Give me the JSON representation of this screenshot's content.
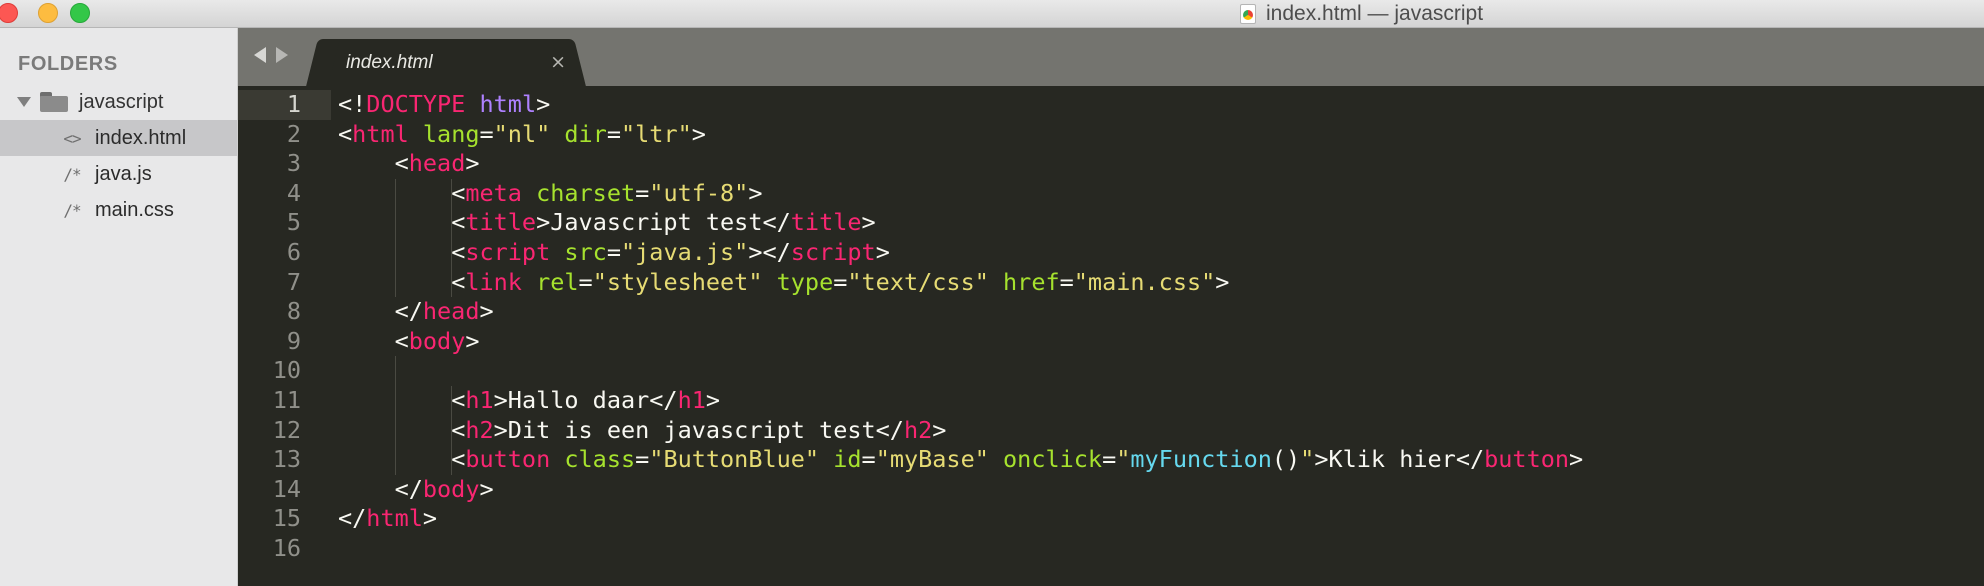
{
  "window": {
    "title": "index.html — javascript"
  },
  "sidebar": {
    "header": "FOLDERS",
    "folder": {
      "name": "javascript"
    },
    "files": [
      {
        "icon": "<>",
        "name": "index.html",
        "selected": true
      },
      {
        "icon": "/*",
        "name": "java.js",
        "selected": false
      },
      {
        "icon": "/*",
        "name": "main.css",
        "selected": false
      }
    ]
  },
  "tab": {
    "label": "index.html",
    "close": "×"
  },
  "editor": {
    "current_line": 1,
    "lines": [
      {
        "n": "1",
        "indent": 0,
        "tokens": [
          [
            "pun",
            "<!"
          ],
          [
            "tag",
            "DOCTYPE"
          ],
          [
            "txt",
            " "
          ],
          [
            "kw",
            "html"
          ],
          [
            "pun",
            ">"
          ]
        ]
      },
      {
        "n": "2",
        "indent": 0,
        "tokens": [
          [
            "pun",
            "<"
          ],
          [
            "tag",
            "html"
          ],
          [
            "txt",
            " "
          ],
          [
            "attr",
            "lang"
          ],
          [
            "pun",
            "="
          ],
          [
            "str",
            "\"nl\""
          ],
          [
            "txt",
            " "
          ],
          [
            "attr",
            "dir"
          ],
          [
            "pun",
            "="
          ],
          [
            "str",
            "\"ltr\""
          ],
          [
            "pun",
            ">"
          ]
        ]
      },
      {
        "n": "3",
        "indent": 1,
        "tokens": [
          [
            "pun",
            "<"
          ],
          [
            "tag",
            "head"
          ],
          [
            "pun",
            ">"
          ]
        ]
      },
      {
        "n": "4",
        "indent": 2,
        "tokens": [
          [
            "pun",
            "<"
          ],
          [
            "tag",
            "meta"
          ],
          [
            "txt",
            " "
          ],
          [
            "attr",
            "charset"
          ],
          [
            "pun",
            "="
          ],
          [
            "str",
            "\"utf-8\""
          ],
          [
            "pun",
            ">"
          ]
        ]
      },
      {
        "n": "5",
        "indent": 2,
        "tokens": [
          [
            "pun",
            "<"
          ],
          [
            "tag",
            "title"
          ],
          [
            "pun",
            ">"
          ],
          [
            "txt",
            "Javascript test"
          ],
          [
            "pun",
            "</"
          ],
          [
            "tag",
            "title"
          ],
          [
            "pun",
            ">"
          ]
        ]
      },
      {
        "n": "6",
        "indent": 2,
        "tokens": [
          [
            "pun",
            "<"
          ],
          [
            "tag",
            "script"
          ],
          [
            "txt",
            " "
          ],
          [
            "attr",
            "src"
          ],
          [
            "pun",
            "="
          ],
          [
            "str",
            "\"java.js\""
          ],
          [
            "pun",
            "></"
          ],
          [
            "tag",
            "script"
          ],
          [
            "pun",
            ">"
          ]
        ]
      },
      {
        "n": "7",
        "indent": 2,
        "tokens": [
          [
            "pun",
            "<"
          ],
          [
            "tag",
            "link"
          ],
          [
            "txt",
            " "
          ],
          [
            "attr",
            "rel"
          ],
          [
            "pun",
            "="
          ],
          [
            "str",
            "\"stylesheet\""
          ],
          [
            "txt",
            " "
          ],
          [
            "attr",
            "type"
          ],
          [
            "pun",
            "="
          ],
          [
            "str",
            "\"text/css\""
          ],
          [
            "txt",
            " "
          ],
          [
            "attr",
            "href"
          ],
          [
            "pun",
            "="
          ],
          [
            "str",
            "\"main.css\""
          ],
          [
            "pun",
            ">"
          ]
        ]
      },
      {
        "n": "8",
        "indent": 1,
        "tokens": [
          [
            "pun",
            "</"
          ],
          [
            "tag",
            "head"
          ],
          [
            "pun",
            ">"
          ]
        ]
      },
      {
        "n": "9",
        "indent": 1,
        "tokens": [
          [
            "pun",
            "<"
          ],
          [
            "tag",
            "body"
          ],
          [
            "pun",
            ">"
          ]
        ]
      },
      {
        "n": "10",
        "indent": 0,
        "tokens": []
      },
      {
        "n": "11",
        "indent": 2,
        "tokens": [
          [
            "pun",
            "<"
          ],
          [
            "tag",
            "h1"
          ],
          [
            "pun",
            ">"
          ],
          [
            "txt",
            "Hallo daar"
          ],
          [
            "pun",
            "</"
          ],
          [
            "tag",
            "h1"
          ],
          [
            "pun",
            ">"
          ]
        ]
      },
      {
        "n": "12",
        "indent": 2,
        "tokens": [
          [
            "pun",
            "<"
          ],
          [
            "tag",
            "h2"
          ],
          [
            "pun",
            ">"
          ],
          [
            "txt",
            "Dit is een javascript test"
          ],
          [
            "pun",
            "</"
          ],
          [
            "tag",
            "h2"
          ],
          [
            "pun",
            ">"
          ]
        ]
      },
      {
        "n": "13",
        "indent": 2,
        "tokens": [
          [
            "pun",
            "<"
          ],
          [
            "tag",
            "button"
          ],
          [
            "txt",
            " "
          ],
          [
            "attr",
            "class"
          ],
          [
            "pun",
            "="
          ],
          [
            "str",
            "\"ButtonBlue\""
          ],
          [
            "txt",
            " "
          ],
          [
            "attr",
            "id"
          ],
          [
            "pun",
            "="
          ],
          [
            "str",
            "\"myBase\""
          ],
          [
            "txt",
            " "
          ],
          [
            "attr",
            "onclick"
          ],
          [
            "pun",
            "="
          ],
          [
            "str",
            "\""
          ],
          [
            "fn",
            "myFunction"
          ],
          [
            "pun",
            "()"
          ],
          [
            "str",
            "\""
          ],
          [
            "pun",
            ">"
          ],
          [
            "txt",
            "Klik hier"
          ],
          [
            "pun",
            "</"
          ],
          [
            "tag",
            "button"
          ],
          [
            "pun",
            ">"
          ]
        ]
      },
      {
        "n": "14",
        "indent": 1,
        "tokens": [
          [
            "pun",
            "</"
          ],
          [
            "tag",
            "body"
          ],
          [
            "pun",
            ">"
          ]
        ]
      },
      {
        "n": "15",
        "indent": 0,
        "tokens": [
          [
            "pun",
            "</"
          ],
          [
            "tag",
            "html"
          ],
          [
            "pun",
            ">"
          ]
        ]
      },
      {
        "n": "16",
        "indent": 0,
        "tokens": []
      }
    ]
  }
}
